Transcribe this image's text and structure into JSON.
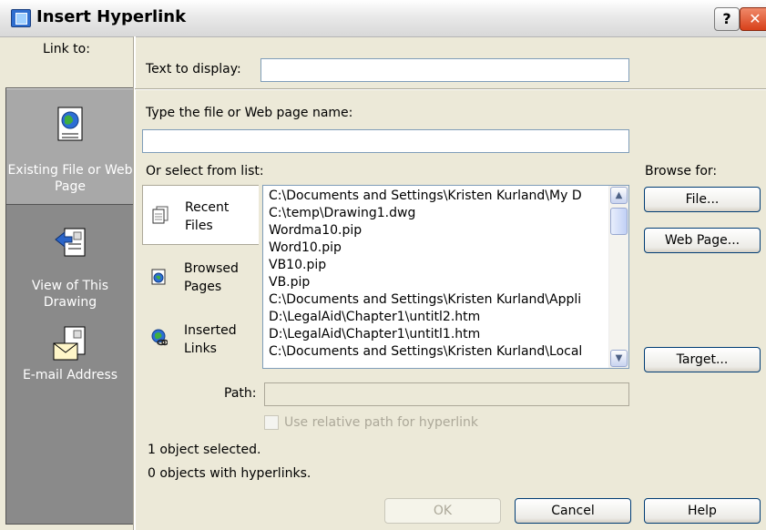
{
  "window": {
    "title": "Insert Hyperlink",
    "help_glyph": "?",
    "close_glyph": "✕"
  },
  "link_to": {
    "label": "Link to:",
    "items": [
      {
        "label": "Existing File or Web Page",
        "icon": "document-globe-icon",
        "active": true
      },
      {
        "label": "View of This Drawing",
        "icon": "view-drawing-icon",
        "active": false
      },
      {
        "label": "E-mail Address",
        "icon": "email-envelope-icon",
        "active": false
      }
    ]
  },
  "text_to_display": {
    "label": "Text to display:",
    "value": ""
  },
  "file_name": {
    "label": "Type the file or Web page name:",
    "value": ""
  },
  "select_from_list": {
    "label": "Or select from list:"
  },
  "browse_for": {
    "label": "Browse for:",
    "file_button": "File...",
    "web_page_button": "Web Page...",
    "target_button": "Target..."
  },
  "list_tabs": [
    {
      "line1": "Recent",
      "line2": "Files",
      "icon": "recent-files-icon",
      "active": true
    },
    {
      "line1": "Browsed",
      "line2": "Pages",
      "icon": "browsed-pages-icon",
      "active": false
    },
    {
      "line1": "Inserted",
      "line2": "Links",
      "icon": "inserted-links-icon",
      "active": false
    }
  ],
  "list_items": [
    "C:\\Documents and Settings\\Kristen Kurland\\My D",
    "C:\\temp\\Drawing1.dwg",
    "Wordma10.pip",
    "Word10.pip",
    "VB10.pip",
    "VB.pip",
    "C:\\Documents and Settings\\Kristen Kurland\\Appli",
    "D:\\LegalAid\\Chapter1\\untitl2.htm",
    "D:\\LegalAid\\Chapter1\\untitl1.htm",
    "C:\\Documents and Settings\\Kristen Kurland\\Local"
  ],
  "path": {
    "label": "Path:",
    "value": ""
  },
  "relative_path": {
    "label": "Use relative path for hyperlink",
    "checked": false
  },
  "status": {
    "line1": "1 object selected.",
    "line2": "0 objects with hyperlinks."
  },
  "buttons": {
    "ok": "OK",
    "cancel": "Cancel",
    "help": "Help"
  }
}
